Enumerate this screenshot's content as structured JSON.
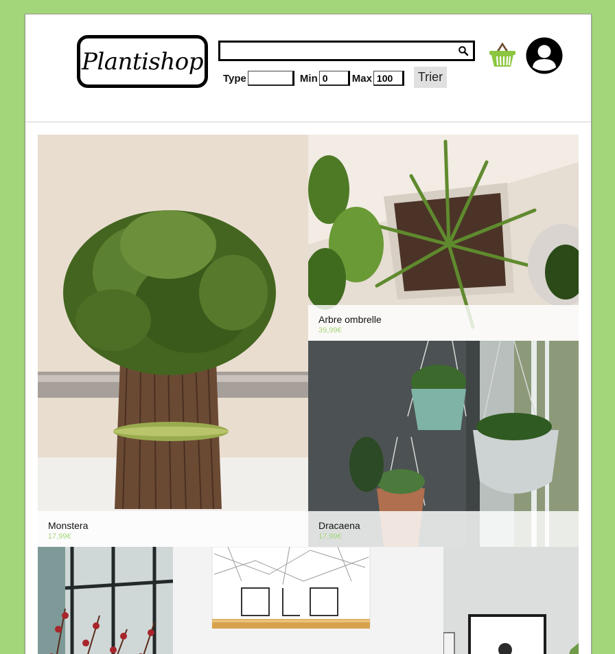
{
  "header": {
    "logo_text": "Plantishop",
    "search": {
      "value": "",
      "placeholder": ""
    },
    "filters": {
      "type_label": "Type",
      "type_value": "",
      "min_label": "Min",
      "min_value": "0",
      "max_label": "Max",
      "max_value": "100",
      "sort_button": "Trier"
    },
    "icons": {
      "search": "search-icon",
      "basket": "basket-icon",
      "account": "user-avatar-icon"
    }
  },
  "colors": {
    "page_background": "#a3d67a",
    "price": "#a3d67a",
    "basket": "#8cc63f"
  },
  "products": [
    {
      "name": "Monstera",
      "price": "17,99€"
    },
    {
      "name": "Arbre ombrelle",
      "price": "39,99€"
    },
    {
      "name": "Dracaena",
      "price": "17,99€"
    }
  ]
}
